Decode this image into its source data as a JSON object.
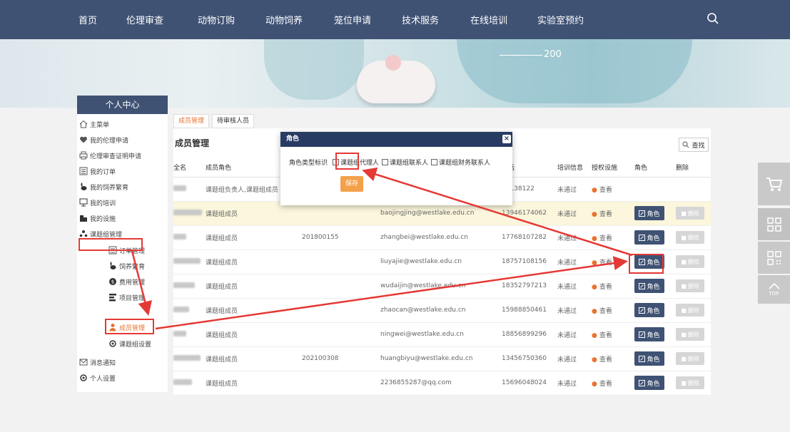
{
  "nav": [
    "首页",
    "伦理审查",
    "动物订购",
    "动物饲养",
    "笼位申请",
    "技术服务",
    "在线培训",
    "实验室预约"
  ],
  "banner_tick": "200",
  "sidebar": {
    "title": "个人中心",
    "items": [
      "主菜单",
      "我的伦理申请",
      "伦理审查证明申请",
      "我的订单",
      "我的饲养繁育",
      "我的培训",
      "我的设施",
      "课题组管理"
    ],
    "sub_items": [
      "订单管理",
      "饲养繁育",
      "费用管理",
      "项目管理",
      "成员管理",
      "课题组设置"
    ],
    "bottom_items": [
      "消息通知",
      "个人设置"
    ]
  },
  "tabs": [
    "成员管理",
    "待审核人员"
  ],
  "main": {
    "title": "成员管理",
    "search_label": "查找"
  },
  "table": {
    "headers": [
      "全名",
      "成员角色",
      "",
      "",
      "电话",
      "培训信息",
      "授权设施",
      "角色",
      "删除"
    ],
    "view_label": "查看",
    "role_label": "角色",
    "delete_label": "删除",
    "rows": [
      {
        "role": "课题组负责人,课题组成员",
        "id": "",
        "email": "",
        "phone": "13138122",
        "training": "未通过"
      },
      {
        "role": "课题组成员",
        "id": "",
        "email": "baojingjing@westlake.edu.cn",
        "phone": "13946174062",
        "training": "未通过"
      },
      {
        "role": "课题组成员",
        "id": "201800155",
        "email": "zhangbei@westlake.edu.cn",
        "phone": "17768107282",
        "training": "未通过"
      },
      {
        "role": "课题组成员",
        "id": "",
        "email": "liuyajie@westlake.edu.cn",
        "phone": "18757108156",
        "training": "未通过"
      },
      {
        "role": "课题组成员",
        "id": "",
        "email": "wudaijin@westlake.edu.cn",
        "phone": "18352797213",
        "training": "未通过"
      },
      {
        "role": "课题组成员",
        "id": "",
        "email": "zhaocan@westlake.edu.cn",
        "phone": "15988850461",
        "training": "未通过"
      },
      {
        "role": "课题组成员",
        "id": "",
        "email": "ningwei@westlake.edu.cn",
        "phone": "18856899296",
        "training": "未通过"
      },
      {
        "role": "课题组成员",
        "id": "202100308",
        "email": "huangbiyu@westlake.edu.cn",
        "phone": "13456750360",
        "training": "未通过"
      },
      {
        "role": "课题组成员",
        "id": "",
        "email": "2236855287@qq.com",
        "phone": "15696048024",
        "training": "未通过"
      }
    ]
  },
  "modal": {
    "title": "角色",
    "field_label": "角色类型标识",
    "options": [
      "课题组代理人",
      "课题组联系人",
      "课题组财务联系人"
    ],
    "save_label": "保存"
  },
  "float_bar": {
    "top_label": "TOP"
  },
  "colors": {
    "nav_bg": "#3f5274",
    "modal_head": "#283c63",
    "save": "#f3a14a",
    "annotation": "#e53935",
    "highlight_row": "#fbf6dc"
  }
}
